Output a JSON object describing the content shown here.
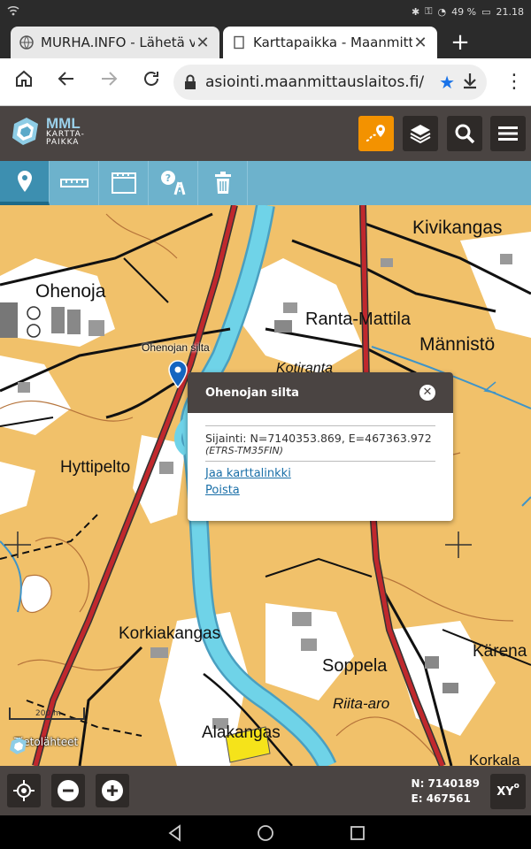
{
  "status_bar": {
    "right_text": "49 %",
    "time": "21.18"
  },
  "browser": {
    "tabs": [
      {
        "title": "MURHA.INFO - Lähetä vas",
        "active": false
      },
      {
        "title": "Karttapaikka - Maanmitta",
        "active": true
      }
    ],
    "url": "asiointi.maanmittauslaitos.fi/"
  },
  "app": {
    "logo_name": "MML",
    "logo_sub1": "KARTTA-",
    "logo_sub2": "PAIKKA"
  },
  "map": {
    "place_labels": [
      {
        "text": "Kivikangas",
        "size": 21
      },
      {
        "text": "Ohenoja",
        "size": 21
      },
      {
        "text": "Ranta-Mattila",
        "size": 20
      },
      {
        "text": "Männistö",
        "size": 21
      },
      {
        "text": "Hyttipelto",
        "size": 19
      },
      {
        "text": "Korkiakangas",
        "size": 19
      },
      {
        "text": "Soppela",
        "size": 20
      },
      {
        "text": "Riita-aro",
        "size": 17
      },
      {
        "text": "Alakangas",
        "size": 19
      },
      {
        "text": "Kärena",
        "size": 19
      },
      {
        "text": "Kotiranta",
        "size": 16
      },
      {
        "text": "Korkala",
        "size": 17
      }
    ],
    "marker_label": "Ohenojan silta",
    "scale_label": "200 m",
    "sources_label": "Tietolähteet"
  },
  "popup": {
    "title": "Ohenojan silta",
    "coords_text": "Sijainti: N=7140353.869, E=467363.972",
    "crs": "(ETRS-TM35FIN)",
    "share_link": "Jaa karttalinkki",
    "remove_link": "Poista"
  },
  "coordinates": {
    "n": "N: 7140189",
    "e": "E: 467561",
    "xy_button": "XY"
  },
  "colors": {
    "header": "#4a4442",
    "toolbar": "#6db2cc",
    "accent_orange": "#f39200",
    "map_bg": "#f1c16a",
    "water": "#6fd3e8"
  }
}
